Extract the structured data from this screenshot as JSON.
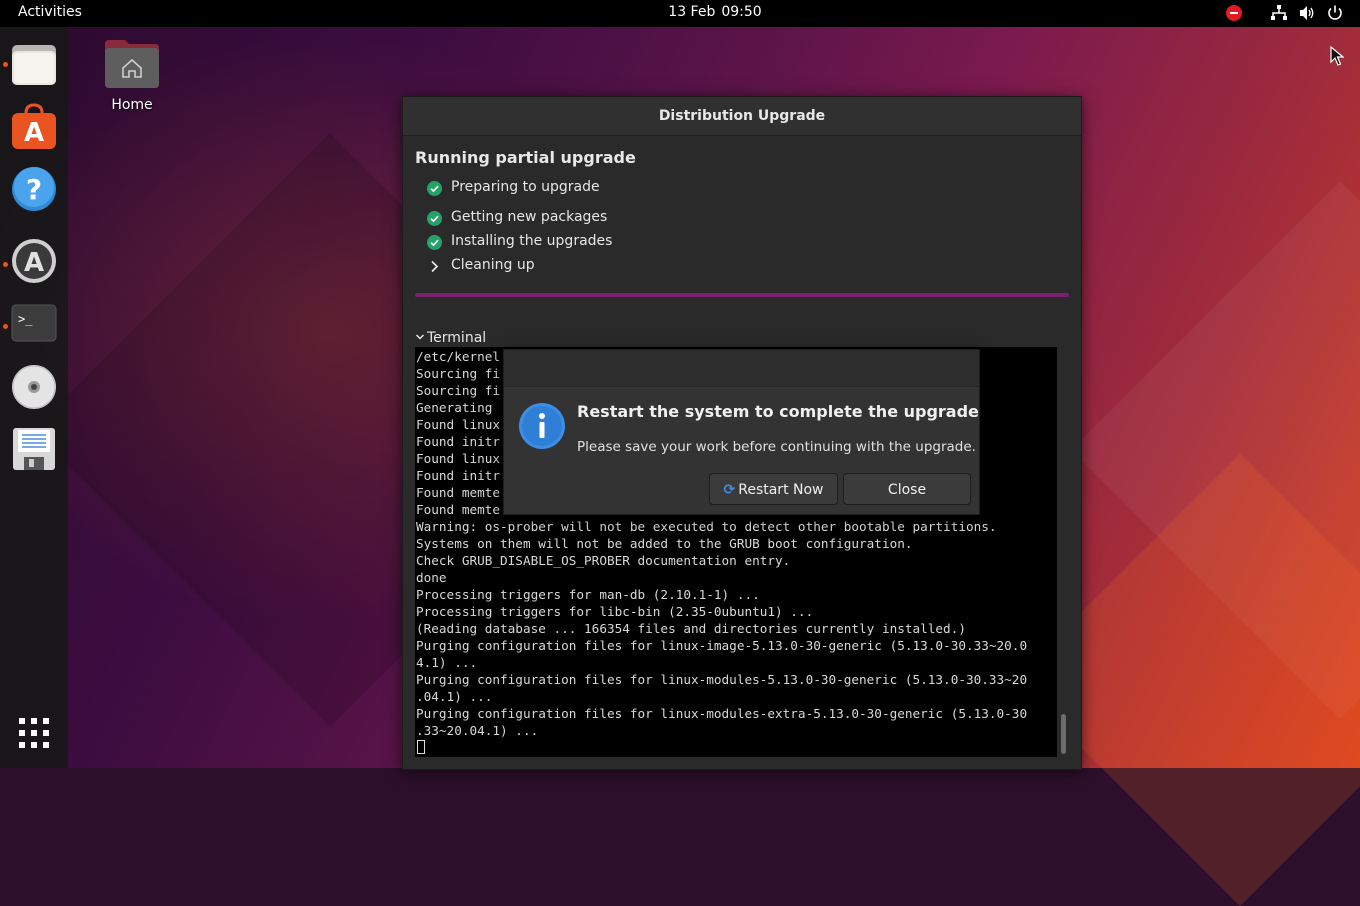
{
  "topbar": {
    "activities": "Activities",
    "date": "13 Feb",
    "time": "09:50"
  },
  "desktop": {
    "home_label": "Home"
  },
  "dock": {
    "items": [
      "files-icon",
      "software-icon",
      "help-icon",
      "software-updater-icon",
      "terminal-icon",
      "cd-drive-icon",
      "save-disk-icon",
      "show-apps-icon"
    ],
    "running_indicator_color": "#e95420"
  },
  "window": {
    "title": "Distribution Upgrade",
    "heading": "Running partial upgrade",
    "steps": [
      {
        "label": "Preparing to upgrade",
        "state": "done"
      },
      {
        "label": "Getting new packages",
        "state": "done"
      },
      {
        "label": "Installing the upgrades",
        "state": "done"
      },
      {
        "label": "Cleaning up",
        "state": "current"
      }
    ],
    "progress": 1.0,
    "progress_color": "#77216f",
    "terminal_label": "Terminal",
    "terminal_lines": "/etc/kernel\nSourcing fi\nSourcing fi\nGenerating \nFound linux\nFound initr\nFound linux\nFound initr\nFound memte\nFound memte\nWarning: os-prober will not be executed to detect other bootable partitions.\nSystems on them will not be added to the GRUB boot configuration.\nCheck GRUB_DISABLE_OS_PROBER documentation entry.\ndone\nProcessing triggers for man-db (2.10.1-1) ...\nProcessing triggers for libc-bin (2.35-0ubuntu1) ...\n(Reading database ... 166354 files and directories currently installed.)\nPurging configuration files for linux-image-5.13.0-30-generic (5.13.0-30.33~20.0\n4.1) ...\nPurging configuration files for linux-modules-5.13.0-30-generic (5.13.0-30.33~20\n.04.1) ...\nPurging configuration files for linux-modules-extra-5.13.0-30-generic (5.13.0-30\n.33~20.04.1) ..."
  },
  "dialog": {
    "heading": "Restart the system to complete the upgrade",
    "body": "Please save your work before continuing with the upgrade.",
    "restart_label": "Restart Now",
    "close_label": "Close",
    "info_color": "#3d8ee6"
  }
}
